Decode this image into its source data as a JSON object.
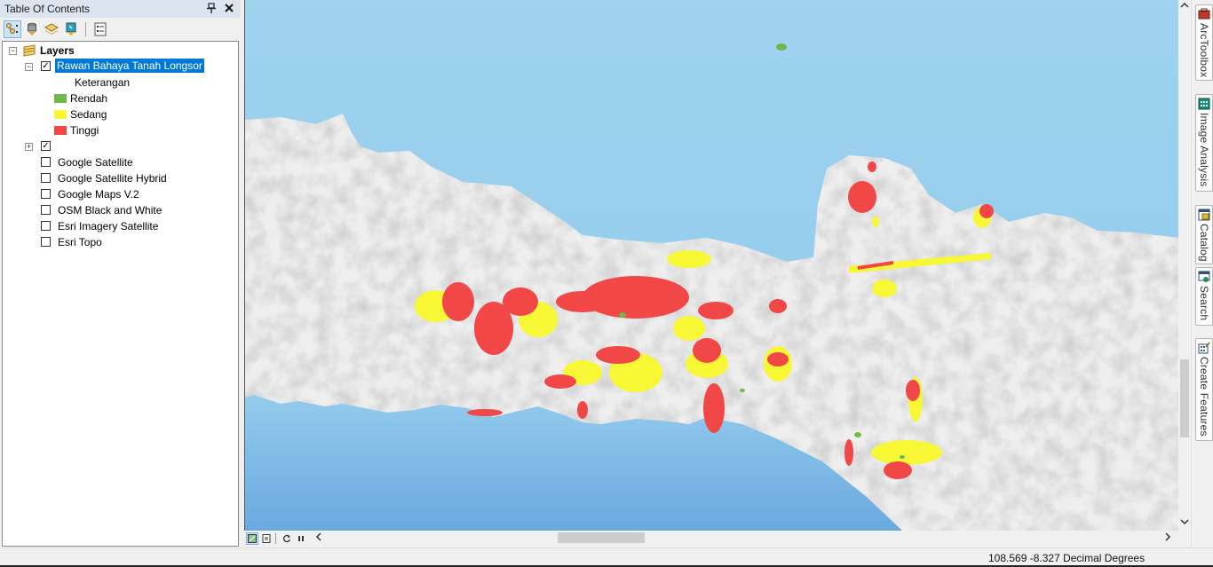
{
  "toc": {
    "title": "Table Of Contents",
    "pin_glyph": "↕",
    "close_glyph": "✕",
    "toolbar": [
      {
        "name": "list-by-drawing-order",
        "active": true
      },
      {
        "name": "list-by-source",
        "active": false
      },
      {
        "name": "list-by-visibility",
        "active": false
      },
      {
        "name": "list-by-selection",
        "active": false
      },
      {
        "name": "options",
        "active": false
      }
    ],
    "root_label": "Layers",
    "layer": {
      "name": "Rawan Bahaya Tanah Longsor",
      "checked": true,
      "legend_heading": "Keterangan",
      "classes": [
        {
          "label": "Rendah",
          "color": "#6bba4a"
        },
        {
          "label": "Sedang",
          "color": "#f7f736"
        },
        {
          "label": "Tinggi",
          "color": "#f24747"
        }
      ]
    },
    "group_checked": true,
    "basemaps": [
      {
        "label": "Google Satellite",
        "checked": false
      },
      {
        "label": "Google Satellite Hybrid",
        "checked": false
      },
      {
        "label": "Google Maps V.2",
        "checked": false
      },
      {
        "label": "OSM Black and White",
        "checked": false
      },
      {
        "label": "Esri Imagery Satellite",
        "checked": false
      },
      {
        "label": "Esri Topo",
        "checked": false
      }
    ]
  },
  "dock_tabs": [
    {
      "label": "ArcToolbox",
      "icon": "toolbox-icon"
    },
    {
      "label": "Image Analysis",
      "icon": "image-analysis-icon"
    },
    {
      "label": "Catalog",
      "icon": "catalog-icon"
    },
    {
      "label": "Search",
      "icon": "search-icon"
    },
    {
      "label": "Create Features",
      "icon": "create-features-icon"
    }
  ],
  "map": {
    "colors": {
      "sea": "#9fd3ee",
      "sea_deep": "#6aa9e0",
      "land": "#eeeeee",
      "relief": "#c9c9c9",
      "rendah": "#6bba4a",
      "sedang": "#f7f736",
      "tinggi": "#f24747"
    }
  },
  "map_nav": {
    "left_arrow": "<",
    "right_arrow": ">",
    "up_arrow": "^",
    "down_arrow": "v"
  },
  "status": {
    "coordinates": "108.569  -8.327 Decimal Degrees"
  }
}
